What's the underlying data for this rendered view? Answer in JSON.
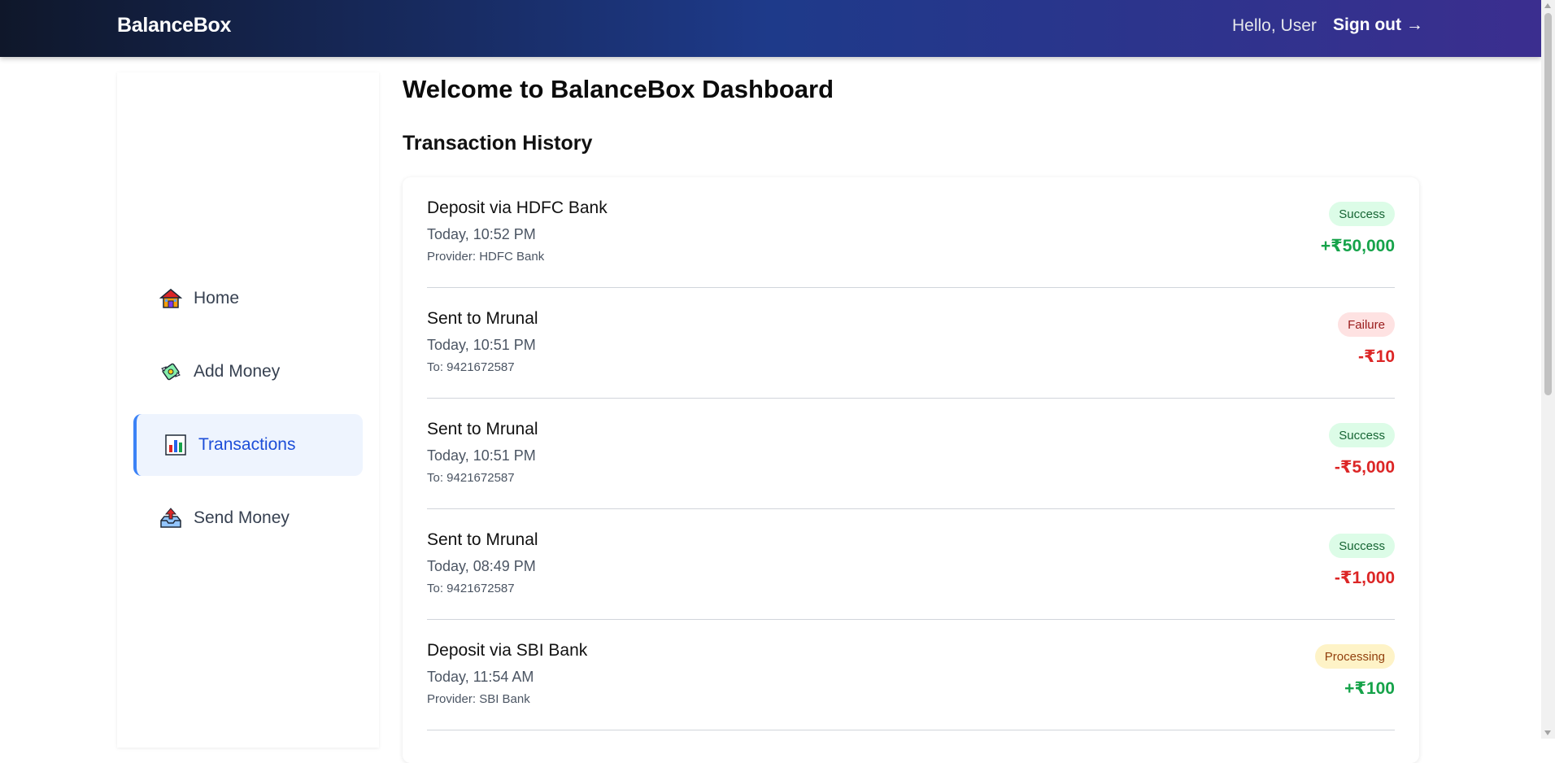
{
  "header": {
    "brand": "BalanceBox",
    "greeting": "Hello, User",
    "signout_label": "Sign out →"
  },
  "sidebar": {
    "items": [
      {
        "label": "Home",
        "icon": "house-icon"
      },
      {
        "label": "Add Money",
        "icon": "money-wings-icon"
      },
      {
        "label": "Transactions",
        "icon": "bar-chart-icon",
        "active": true
      },
      {
        "label": "Send Money",
        "icon": "outbox-tray-icon"
      }
    ]
  },
  "main": {
    "title": "Welcome to BalanceBox Dashboard",
    "section_title": "Transaction History",
    "transactions": [
      {
        "title": "Deposit via HDFC Bank",
        "time": "Today, 10:52 PM",
        "sub": "Provider: HDFC Bank",
        "status": "Success",
        "amount": "+₹50,000"
      },
      {
        "title": "Sent to Mrunal",
        "time": "Today, 10:51 PM",
        "sub": "To: 9421672587",
        "status": "Failure",
        "amount": "-₹10"
      },
      {
        "title": "Sent to Mrunal",
        "time": "Today, 10:51 PM",
        "sub": "To: 9421672587",
        "status": "Success",
        "amount": "-₹5,000"
      },
      {
        "title": "Sent to Mrunal",
        "time": "Today, 08:49 PM",
        "sub": "To: 9421672587",
        "status": "Success",
        "amount": "-₹1,000"
      },
      {
        "title": "Deposit via SBI Bank",
        "time": "Today, 11:54 AM",
        "sub": "Provider: SBI Bank",
        "status": "Processing",
        "amount": "+₹100"
      }
    ]
  },
  "colors": {
    "success_bg": "#dcfce7",
    "failure_bg": "#fee2e2",
    "processing_bg": "#fef3c7",
    "positive_amount": "#16a34a",
    "negative_amount": "#dc2626",
    "active_nav": "#1d4ed8"
  }
}
